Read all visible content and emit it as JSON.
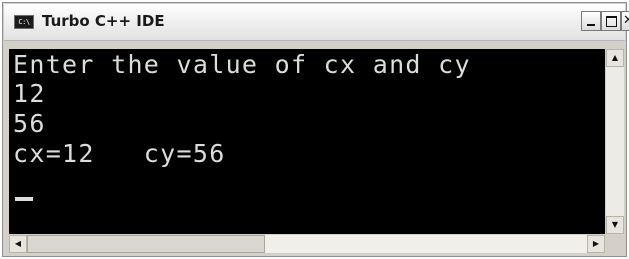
{
  "window": {
    "title": "Turbo C++ IDE",
    "icon_label": "C:\\",
    "icon_name": "console-window-icon"
  },
  "controls": {
    "minimize": "minimize-icon",
    "maximize": "maximize-icon",
    "close": "close-icon"
  },
  "console": {
    "lines": [
      "Enter the value of cx and cy",
      "12",
      "56",
      "cx=12   cy=56"
    ],
    "cursor": "_"
  },
  "scrollbars": {
    "up_arrow": "▲",
    "down_arrow": "▼",
    "left_arrow": "◀",
    "right_arrow": "▶"
  },
  "colors": {
    "console_background": "#000000",
    "console_text": "#dcdcdc",
    "frame": "#d4d0c8"
  }
}
